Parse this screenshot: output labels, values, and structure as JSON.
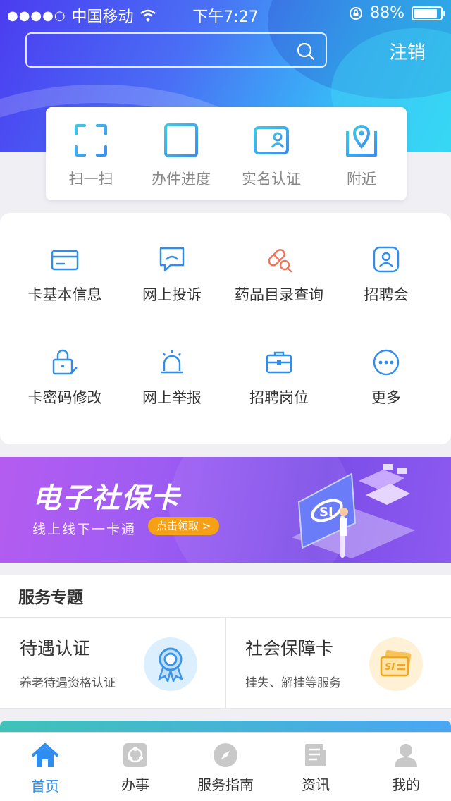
{
  "status_bar": {
    "carrier": "中国移动",
    "time": "下午7:27",
    "battery": "88%",
    "battery_level": 0.88
  },
  "header": {
    "search_placeholder": "",
    "logout_label": "注销"
  },
  "quick_actions": [
    {
      "label": "扫一扫",
      "icon": "scan-icon"
    },
    {
      "label": "办件进度",
      "icon": "progress-list-icon"
    },
    {
      "label": "实名认证",
      "icon": "id-card-icon"
    },
    {
      "label": "附近",
      "icon": "map-pin-icon"
    }
  ],
  "services": [
    {
      "label": "卡基本信息",
      "icon": "card-icon"
    },
    {
      "label": "网上投诉",
      "icon": "complaint-chat-icon"
    },
    {
      "label": "药品目录查询",
      "icon": "pill-search-icon"
    },
    {
      "label": "招聘会",
      "icon": "job-fair-icon"
    },
    {
      "label": "卡密码修改",
      "icon": "lock-edit-icon"
    },
    {
      "label": "网上举报",
      "icon": "alarm-light-icon"
    },
    {
      "label": "招聘岗位",
      "icon": "briefcase-icon"
    },
    {
      "label": "更多",
      "icon": "more-icon"
    }
  ],
  "banner": {
    "title": "电子社保卡",
    "subtitle": "线上线下一卡通",
    "button_label": "点击领取 >"
  },
  "topics": {
    "title": "服务专题",
    "items": [
      {
        "name": "待遇认证",
        "desc": "养老待遇资格认证",
        "icon": "ribbon-badge-icon",
        "color": "#dcefff"
      },
      {
        "name": "社会保障卡",
        "desc": "挂失、解挂等服务",
        "icon": "si-card-icon",
        "color": "#fff1d6"
      }
    ]
  },
  "tabbar": [
    {
      "label": "首页",
      "icon": "home-icon",
      "active": true
    },
    {
      "label": "办事",
      "icon": "affairs-icon",
      "active": false
    },
    {
      "label": "服务指南",
      "icon": "compass-icon",
      "active": false
    },
    {
      "label": "资讯",
      "icon": "news-icon",
      "active": false
    },
    {
      "label": "我的",
      "icon": "user-icon",
      "active": false
    }
  ],
  "colors": {
    "accent_blue": "#2e8df0",
    "header_gradient_start": "#4b3cf0",
    "header_gradient_end": "#2fd6f2",
    "banner_button": "#f6a015"
  }
}
